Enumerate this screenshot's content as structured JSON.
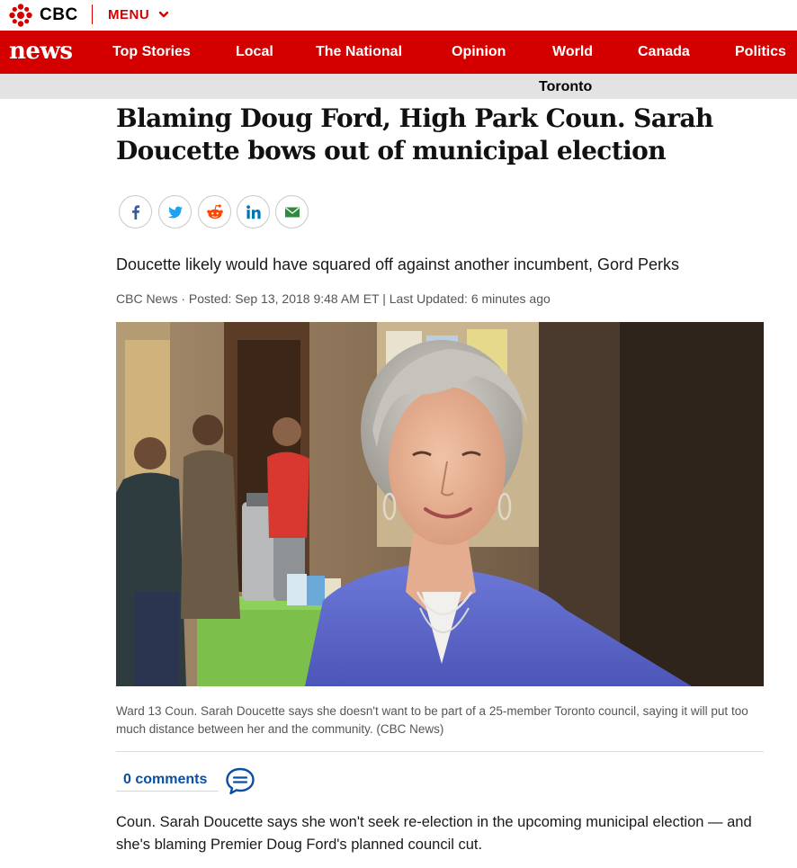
{
  "header": {
    "brand": "CBC",
    "menu_label": "MENU"
  },
  "nav": {
    "logo": "news",
    "items": [
      {
        "label": "Top Stories"
      },
      {
        "label": "Local"
      },
      {
        "label": "The National"
      },
      {
        "label": "Opinion"
      },
      {
        "label": "World"
      },
      {
        "label": "Canada"
      },
      {
        "label": "Politics"
      }
    ]
  },
  "section": {
    "label": "Toronto"
  },
  "article": {
    "headline": "Blaming Doug Ford, High Park Coun. Sarah Doucette bows out of municipal election",
    "deck": "Doucette likely would have squared off against another incumbent, Gord Perks",
    "byline": "CBC News · Posted: Sep 13, 2018 9:48 AM ET | Last Updated: 6 minutes ago",
    "caption": "Ward 13 Coun. Sarah Doucette says she doesn't want to be part of a 25-member Toronto council, saying it will put too much distance between her and the community. (CBC News)",
    "comments_label": "0 comments",
    "body": "Coun. Sarah Doucette says she won't seek re-election in the upcoming municipal election — and she's blaming Premier Doug Ford's planned council cut."
  },
  "share": {
    "buttons": [
      {
        "icon": "facebook-icon",
        "color": "#3b5998"
      },
      {
        "icon": "twitter-icon",
        "color": "#1da1f2"
      },
      {
        "icon": "reddit-icon",
        "color": "#ff4500"
      },
      {
        "icon": "linkedin-icon",
        "color": "#0077b5"
      },
      {
        "icon": "email-icon",
        "color": "#2e8b3d"
      }
    ]
  },
  "colors": {
    "brand_red": "#d40000",
    "link_blue": "#0b4fa3",
    "section_bar": "#e3e3e3"
  }
}
